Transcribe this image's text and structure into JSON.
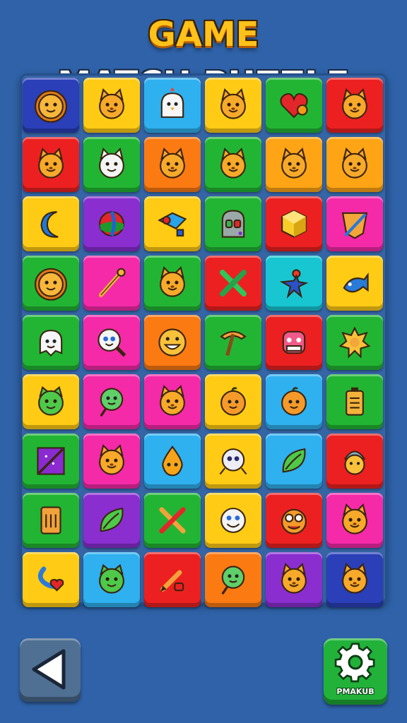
{
  "title": {
    "word1": "GAME",
    "word2": "MATCH PUZZLE"
  },
  "controls": {
    "back_icon": "play-left-triangle-icon",
    "settings_icon": "gear-icon",
    "settings_label": "PMAKUB"
  },
  "colors": {
    "navy": "#2a3fb8",
    "yellow": "#ffcb14",
    "sky": "#2fb0ef",
    "red": "#ec2020",
    "green": "#22b533",
    "orange": "#fb7a12",
    "purple": "#8a2ed0",
    "pink": "#f52aa8",
    "teal": "#18c6d2",
    "amber": "#ffa414"
  },
  "tiles": [
    [
      {
        "c": "navy",
        "i": "lion-face"
      },
      {
        "c": "yellow",
        "i": "cat-face"
      },
      {
        "c": "sky",
        "i": "ghost-chick"
      },
      {
        "c": "yellow",
        "i": "cat-face"
      },
      {
        "c": "green",
        "i": "heart"
      },
      {
        "c": "red",
        "i": "cat-face"
      }
    ],
    [
      {
        "c": "red",
        "i": "cat-face"
      },
      {
        "c": "green",
        "i": "white-cat-face"
      },
      {
        "c": "orange",
        "i": "cat-face"
      },
      {
        "c": "green",
        "i": "cat-face"
      },
      {
        "c": "amber",
        "i": "cat-face"
      },
      {
        "c": "amber",
        "i": "cat-face"
      }
    ],
    [
      {
        "c": "yellow",
        "i": "crescent-moon"
      },
      {
        "c": "purple",
        "i": "beach-ball"
      },
      {
        "c": "yellow",
        "i": "bird-kite"
      },
      {
        "c": "green",
        "i": "robot-head"
      },
      {
        "c": "red",
        "i": "hexagon-gem"
      },
      {
        "c": "pink",
        "i": "shield-bow"
      }
    ],
    [
      {
        "c": "green",
        "i": "lion-face"
      },
      {
        "c": "pink",
        "i": "stick-wand"
      },
      {
        "c": "green",
        "i": "cat-face"
      },
      {
        "c": "red",
        "i": "crossed-swords"
      },
      {
        "c": "teal",
        "i": "star-figure"
      },
      {
        "c": "yellow",
        "i": "fish"
      }
    ],
    [
      {
        "c": "green",
        "i": "ghost-face"
      },
      {
        "c": "pink",
        "i": "magnifier-face"
      },
      {
        "c": "orange",
        "i": "grin-face"
      },
      {
        "c": "green",
        "i": "pickaxe"
      },
      {
        "c": "red",
        "i": "monster-face"
      },
      {
        "c": "green",
        "i": "sun-gear"
      }
    ],
    [
      {
        "c": "yellow",
        "i": "green-cat-face"
      },
      {
        "c": "pink",
        "i": "lollipop-face"
      },
      {
        "c": "pink",
        "i": "cat-face"
      },
      {
        "c": "yellow",
        "i": "orange-face"
      },
      {
        "c": "sky",
        "i": "orange-face"
      },
      {
        "c": "green",
        "i": "battery"
      }
    ],
    [
      {
        "c": "green",
        "i": "crossed-box"
      },
      {
        "c": "pink",
        "i": "cat-face"
      },
      {
        "c": "sky",
        "i": "drop-face"
      },
      {
        "c": "yellow",
        "i": "spider-face"
      },
      {
        "c": "sky",
        "i": "leaf"
      },
      {
        "c": "red",
        "i": "beanie-face"
      }
    ],
    [
      {
        "c": "green",
        "i": "scroll-tablet"
      },
      {
        "c": "purple",
        "i": "leaf"
      },
      {
        "c": "green",
        "i": "crossed-tools"
      },
      {
        "c": "yellow",
        "i": "smile-face"
      },
      {
        "c": "red",
        "i": "goggle-face"
      },
      {
        "c": "pink",
        "i": "cat-face"
      }
    ],
    [
      {
        "c": "yellow",
        "i": "swirl-heart"
      },
      {
        "c": "sky",
        "i": "green-cat-face"
      },
      {
        "c": "red",
        "i": "pencil"
      },
      {
        "c": "orange",
        "i": "lollipop-face"
      },
      {
        "c": "purple",
        "i": "cat-face"
      },
      {
        "c": "navy",
        "i": "cat-face"
      }
    ]
  ]
}
